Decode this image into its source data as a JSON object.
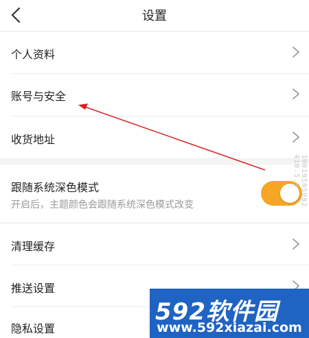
{
  "header": {
    "title": "设置",
    "back_icon": "chevron-left-icon"
  },
  "sections": {
    "account": [
      {
        "label": "个人资料",
        "icon": "chevron-right-icon"
      },
      {
        "label": "账号与安全",
        "icon": "chevron-right-icon"
      },
      {
        "label": "收货地址",
        "icon": "chevron-right-icon"
      }
    ],
    "dark_mode": {
      "label": "跟随系统深色模式",
      "description": "开启后，主题颜色会跟随系统深色模式改变",
      "toggle_on": true,
      "toggle_color": "#f5a623"
    },
    "misc": [
      {
        "label": "清理缓存",
        "icon": "chevron-right-icon"
      },
      {
        "label": "推送设置",
        "icon": "chevron-right-icon"
      },
      {
        "label": "隐私设置",
        "icon": "chevron-right-icon"
      }
    ]
  },
  "annotation": {
    "arrow_color": "#d81e1e"
  },
  "watermark": {
    "side_text": "10010505082 410.5.0",
    "brand": "592软件园",
    "url": "www.592xiazai.com",
    "banner_color": "#1f63c3"
  }
}
